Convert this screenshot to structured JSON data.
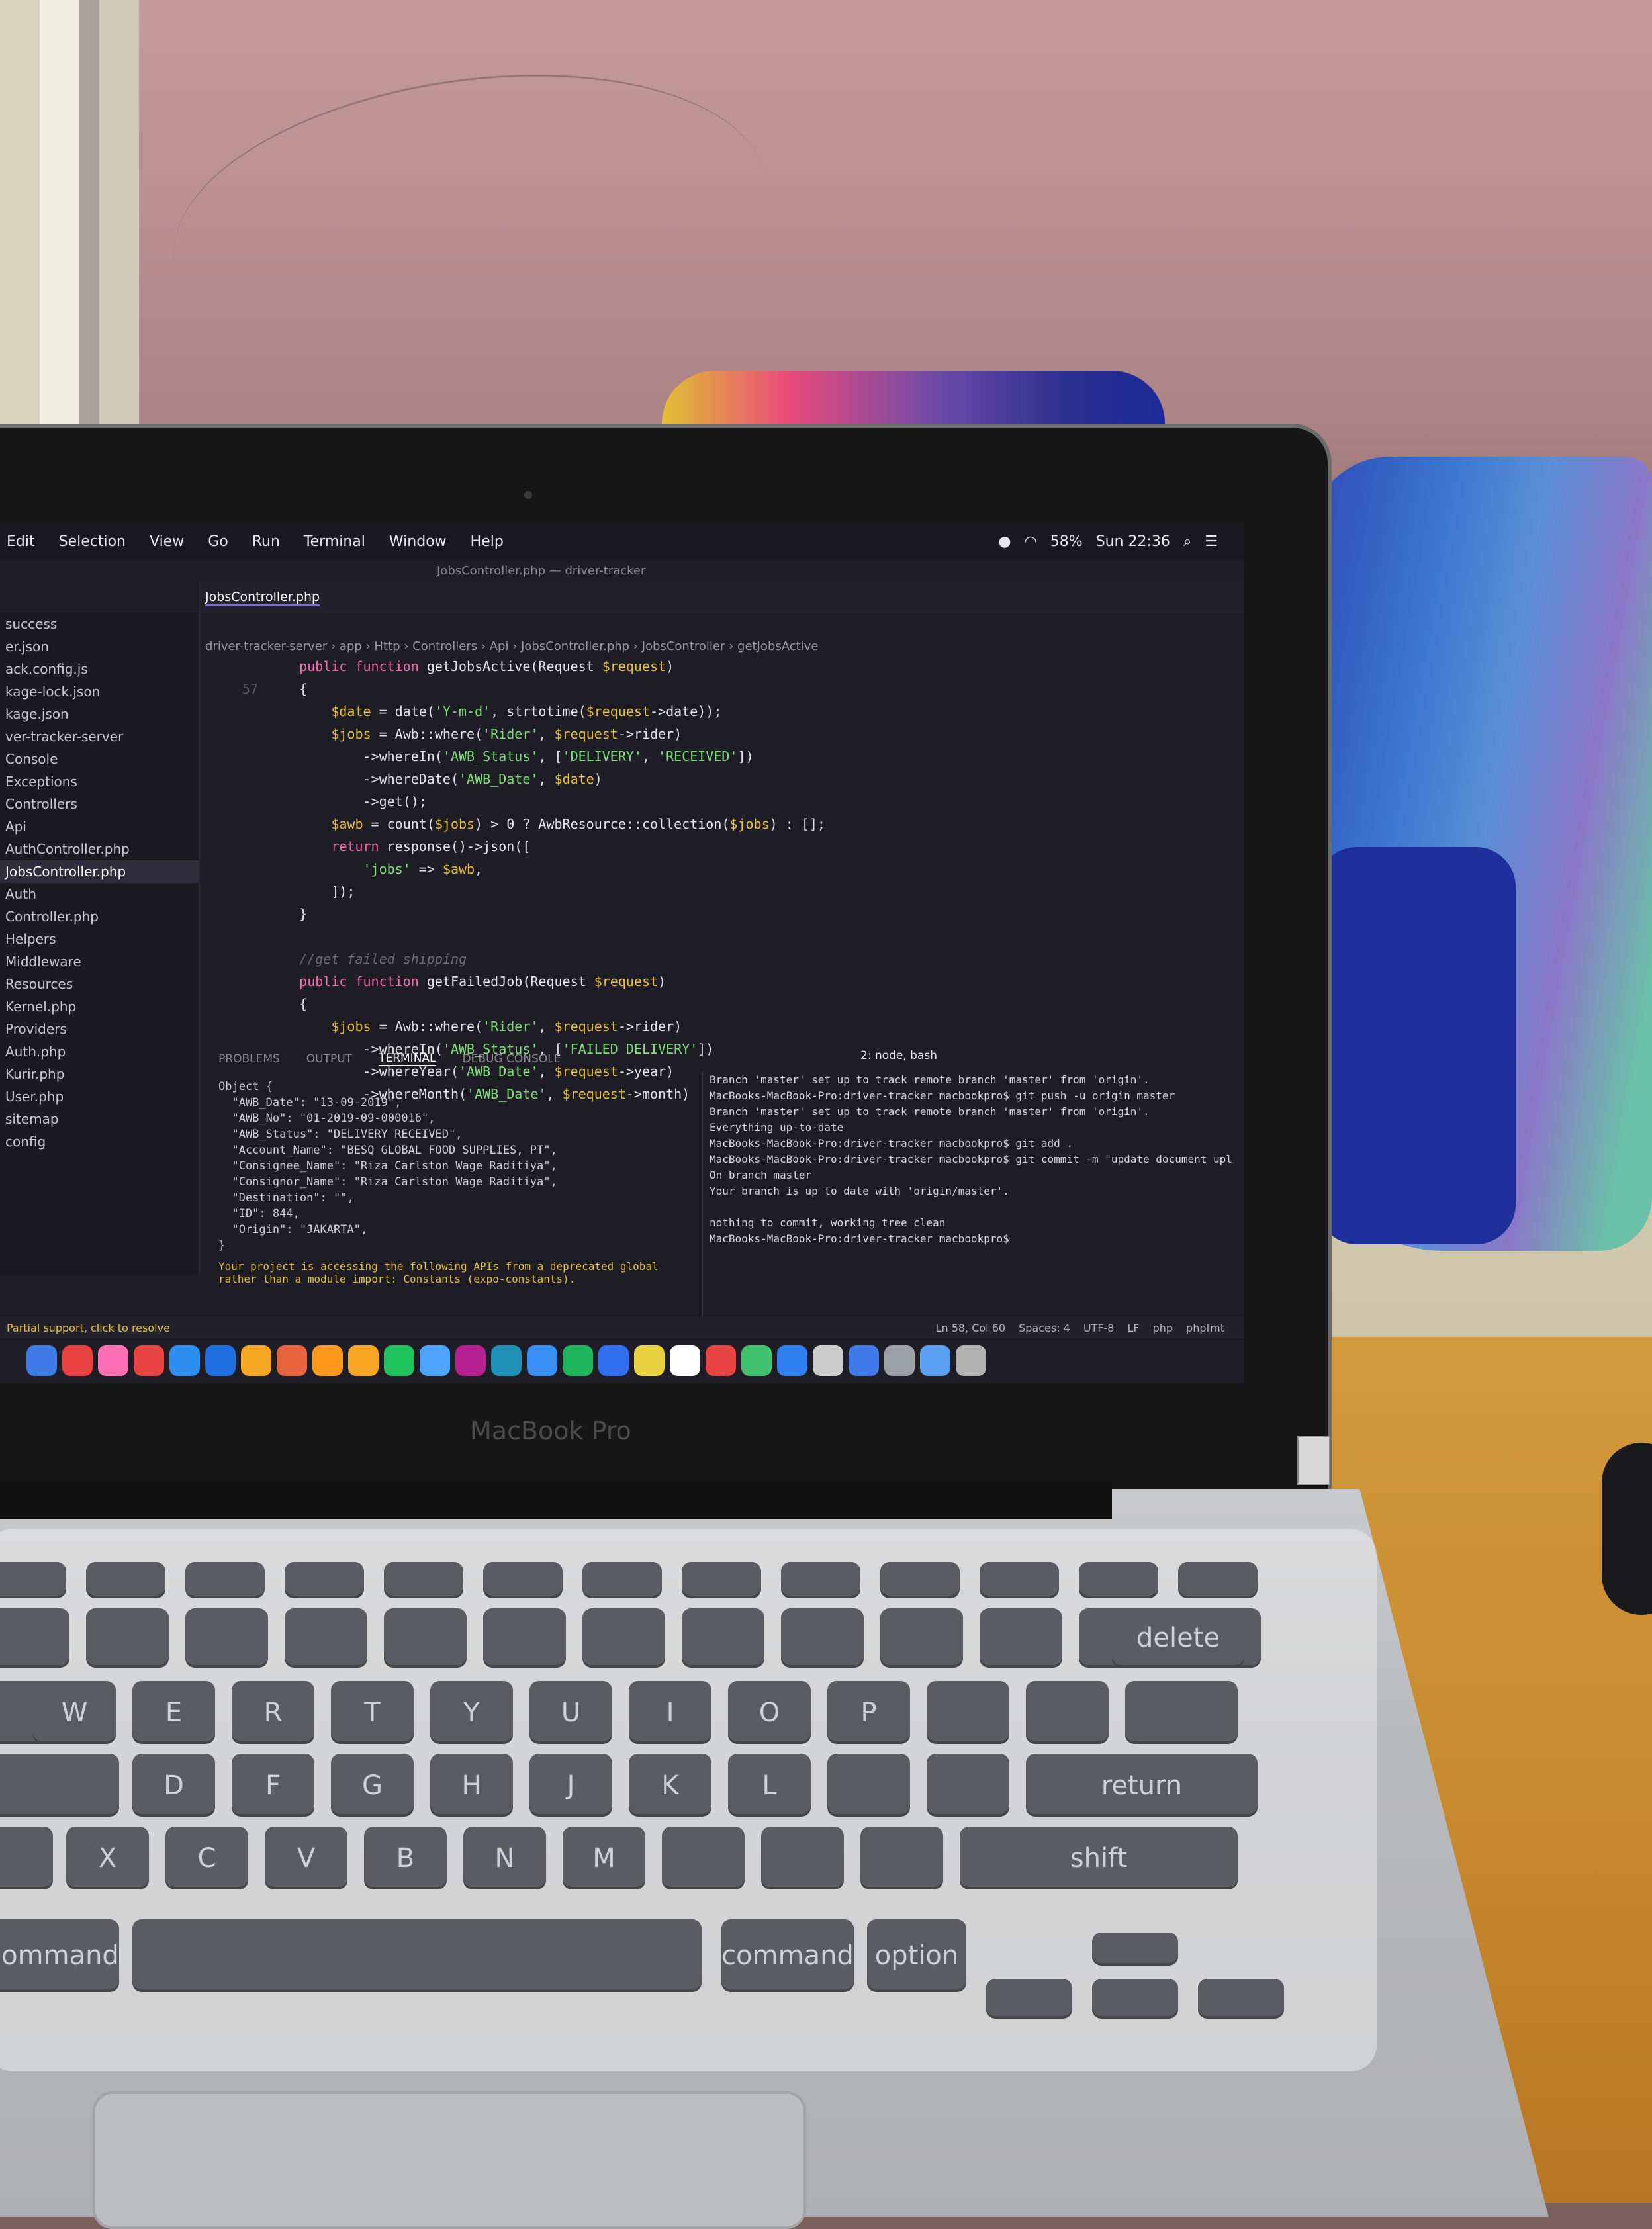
{
  "menubar": {
    "items": [
      "Edit",
      "Selection",
      "View",
      "Go",
      "Run",
      "Terminal",
      "Window",
      "Help"
    ],
    "battery": "58%",
    "clock": "Sun 22:36"
  },
  "window": {
    "title": "JobsController.php — driver-tracker"
  },
  "tabs": [
    "JobsController.php"
  ],
  "breadcrumb": "driver-tracker-server › app › Http › Controllers › Api › JobsController.php › JobsController › getJobsActive",
  "sidebar": {
    "items": [
      "success",
      "er.json",
      "ack.config.js",
      "kage-lock.json",
      "kage.json",
      "ver-tracker-server",
      "Console",
      "Exceptions",
      "Controllers",
      "Api",
      "AuthController.php",
      "JobsController.php",
      "Auth",
      "Controller.php",
      "Helpers",
      "Middleware",
      "Resources",
      "Kernel.php",
      "Providers",
      "Auth.php",
      "Kurir.php",
      "User.php",
      "sitemap",
      "config"
    ],
    "selected_index": 11
  },
  "editor": {
    "start_line": "57",
    "lines": [
      "    public function getJobsActive(Request $request)",
      "    {",
      "        $date = date('Y-m-d', strtotime($request->date));",
      "        $jobs = Awb::where('Rider', $request->rider)",
      "            ->whereIn('AWB_Status', ['DELIVERY', 'RECEIVED'])",
      "            ->whereDate('AWB_Date', $date)",
      "            ->get();",
      "        $awb = count($jobs) > 0 ? AwbResource::collection($jobs) : [];",
      "        return response()->json([",
      "            'jobs' => $awb,",
      "        ]);",
      "    }",
      "",
      "    //get failed shipping",
      "    public function getFailedJob(Request $request)",
      "    {",
      "        $jobs = Awb::where('Rider', $request->rider)",
      "            ->whereIn('AWB_Status', ['FAILED DELIVERY'])",
      "            ->whereYear('AWB_Date', $request->year)",
      "            ->whereMonth('AWB_Date', $request->month)"
    ]
  },
  "panel": {
    "tabs": [
      "PROBLEMS",
      "OUTPUT",
      "TERMINAL",
      "DEBUG CONSOLE"
    ],
    "active_tab": "TERMINAL",
    "shell": "2: node, bash",
    "left_terminal": [
      "Object {",
      "  \"AWB_Date\": \"13-09-2019\",",
      "  \"AWB_No\": \"01-2019-09-000016\",",
      "  \"AWB_Status\": \"DELIVERY RECEIVED\",",
      "  \"Account_Name\": \"BESQ GLOBAL FOOD SUPPLIES, PT\",",
      "  \"Consignee_Name\": \"Riza Carlston Wage Raditiya\",",
      "  \"Consignor_Name\": \"Riza Carlston Wage Raditiya\",",
      "  \"Destination\": \"\",",
      "  \"ID\": 844,",
      "  \"Origin\": \"JAKARTA\",",
      "}"
    ],
    "warning": "Your project is accessing the following APIs from a deprecated global rather than a module import: Constants (expo-constants).",
    "right_terminal": [
      "Branch 'master' set up to track remote branch 'master' from 'origin'.",
      "MacBooks-MacBook-Pro:driver-tracker macbookpro$ git push -u origin master",
      "Branch 'master' set up to track remote branch 'master' from 'origin'.",
      "Everything up-to-date",
      "MacBooks-MacBook-Pro:driver-tracker macbookpro$ git add .",
      "MacBooks-MacBook-Pro:driver-tracker macbookpro$ git commit -m \"update document upload\"",
      "On branch master",
      "Your branch is up to date with 'origin/master'.",
      "",
      "nothing to commit, working tree clean",
      "MacBooks-MacBook-Pro:driver-tracker macbookpro$ "
    ]
  },
  "statusbar": {
    "left": "Partial support, click to resolve",
    "position": "Ln 58, Col 60",
    "spaces": "Spaces: 4",
    "encoding": "UTF-8",
    "eol": "LF",
    "language": "php",
    "formatter": "phpfmt"
  },
  "hardware": {
    "model_label": "MacBook Pro",
    "keys_row_letters": [
      "W",
      "E",
      "R",
      "T",
      "Y",
      "U",
      "I",
      "O",
      "P"
    ],
    "keys_home_row": [
      "D",
      "F",
      "G",
      "H",
      "J",
      "K",
      "L"
    ],
    "keys_bottom_row": [
      "X",
      "C",
      "V",
      "B",
      "N",
      "M"
    ],
    "key_command": "command",
    "key_delete": "delete",
    "key_return": "return",
    "key_shift": "shift",
    "key_option": "option"
  },
  "colors": {
    "editor_bg": "#1e1c24",
    "keyword": "#f06cb0",
    "variable": "#e6c23a",
    "string": "#7ee07a",
    "function": "#7fb0ff",
    "warning": "#e6c23a"
  }
}
